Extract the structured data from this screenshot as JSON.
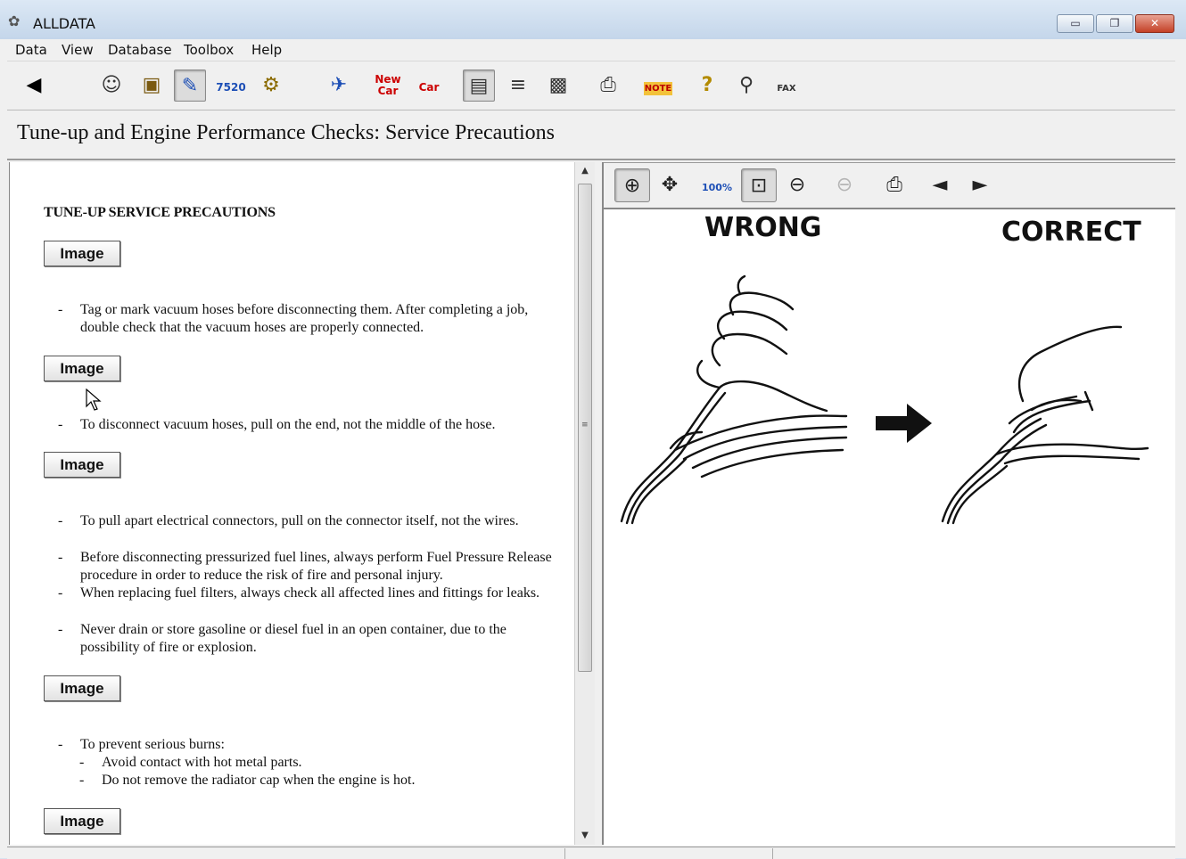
{
  "window": {
    "title": "ALLDATA",
    "controls": {
      "minimize": "▭",
      "maximize": "❐",
      "close": "✕"
    }
  },
  "menu": [
    "Data",
    "View",
    "Database",
    "Toolbox",
    "Help"
  ],
  "toolbar": {
    "icons": [
      {
        "name": "back-icon",
        "glyph": "◀"
      },
      {
        "name": "vehicle-info-icon",
        "glyph": "☺"
      },
      {
        "name": "component-locations-icon",
        "glyph": "▣"
      },
      {
        "name": "repair-tools-icon",
        "glyph": "✎"
      },
      {
        "name": "tsb-icon",
        "label": "7520"
      },
      {
        "name": "specifications-icon",
        "glyph": "⚙"
      },
      {
        "name": "labor-icon",
        "glyph": "✈"
      },
      {
        "name": "new-car-icon",
        "label": "New Car"
      },
      {
        "name": "previous-car-icon",
        "label": "Car"
      },
      {
        "name": "split-view-icon",
        "glyph": "▤"
      },
      {
        "name": "text-view-icon",
        "glyph": "≡"
      },
      {
        "name": "image-view-icon",
        "glyph": "▩"
      },
      {
        "name": "print-icon",
        "glyph": "⎙"
      },
      {
        "name": "notes-icon",
        "label": "NOTE"
      },
      {
        "name": "help-icon",
        "glyph": "?"
      },
      {
        "name": "find-icon",
        "glyph": "⚲"
      },
      {
        "name": "fax-icon",
        "label": "FAX"
      }
    ]
  },
  "page": {
    "title": "Tune-up and Engine Performance Checks:  Service Precautions"
  },
  "document": {
    "heading": "TUNE-UP SERVICE PRECAUTIONS",
    "image_button_label": "Image",
    "bullets": [
      "Tag or mark vacuum hoses before disconnecting them. After completing a job, double check that the vacuum hoses are properly connected.",
      "To disconnect vacuum hoses, pull on the end, not the middle of the hose.",
      "To pull apart electrical connectors, pull on the connector itself, not the wires.",
      "Before disconnecting pressurized fuel lines, always perform Fuel Pressure Release procedure in order to reduce the risk of fire and personal injury.",
      "When replacing fuel filters, always check all affected lines and fittings for leaks.",
      "Never drain or store gasoline or diesel fuel in an open container, due to the possibility of fire or explosion.",
      "To prevent serious burns:"
    ],
    "sub_bullets": [
      "Avoid contact with hot metal parts.",
      "Do not remove the radiator cap when the engine is hot."
    ],
    "dash": "-"
  },
  "image_viewer": {
    "tools": [
      {
        "name": "zoom-in-icon",
        "glyph": "⊕"
      },
      {
        "name": "pan-icon",
        "glyph": "✥"
      },
      {
        "name": "zoom-100-icon",
        "label": "100%"
      },
      {
        "name": "zoom-fit-icon",
        "glyph": "⊡"
      },
      {
        "name": "zoom-width-icon",
        "glyph": "⊖"
      },
      {
        "name": "zoom-out-icon",
        "glyph": "⊖"
      },
      {
        "name": "print-image-icon",
        "glyph": "⎙"
      },
      {
        "name": "previous-image-icon",
        "glyph": "◄"
      },
      {
        "name": "next-image-icon",
        "glyph": "►"
      }
    ],
    "illustration": {
      "left_label": "WRONG",
      "right_label": "CORRECT"
    }
  }
}
